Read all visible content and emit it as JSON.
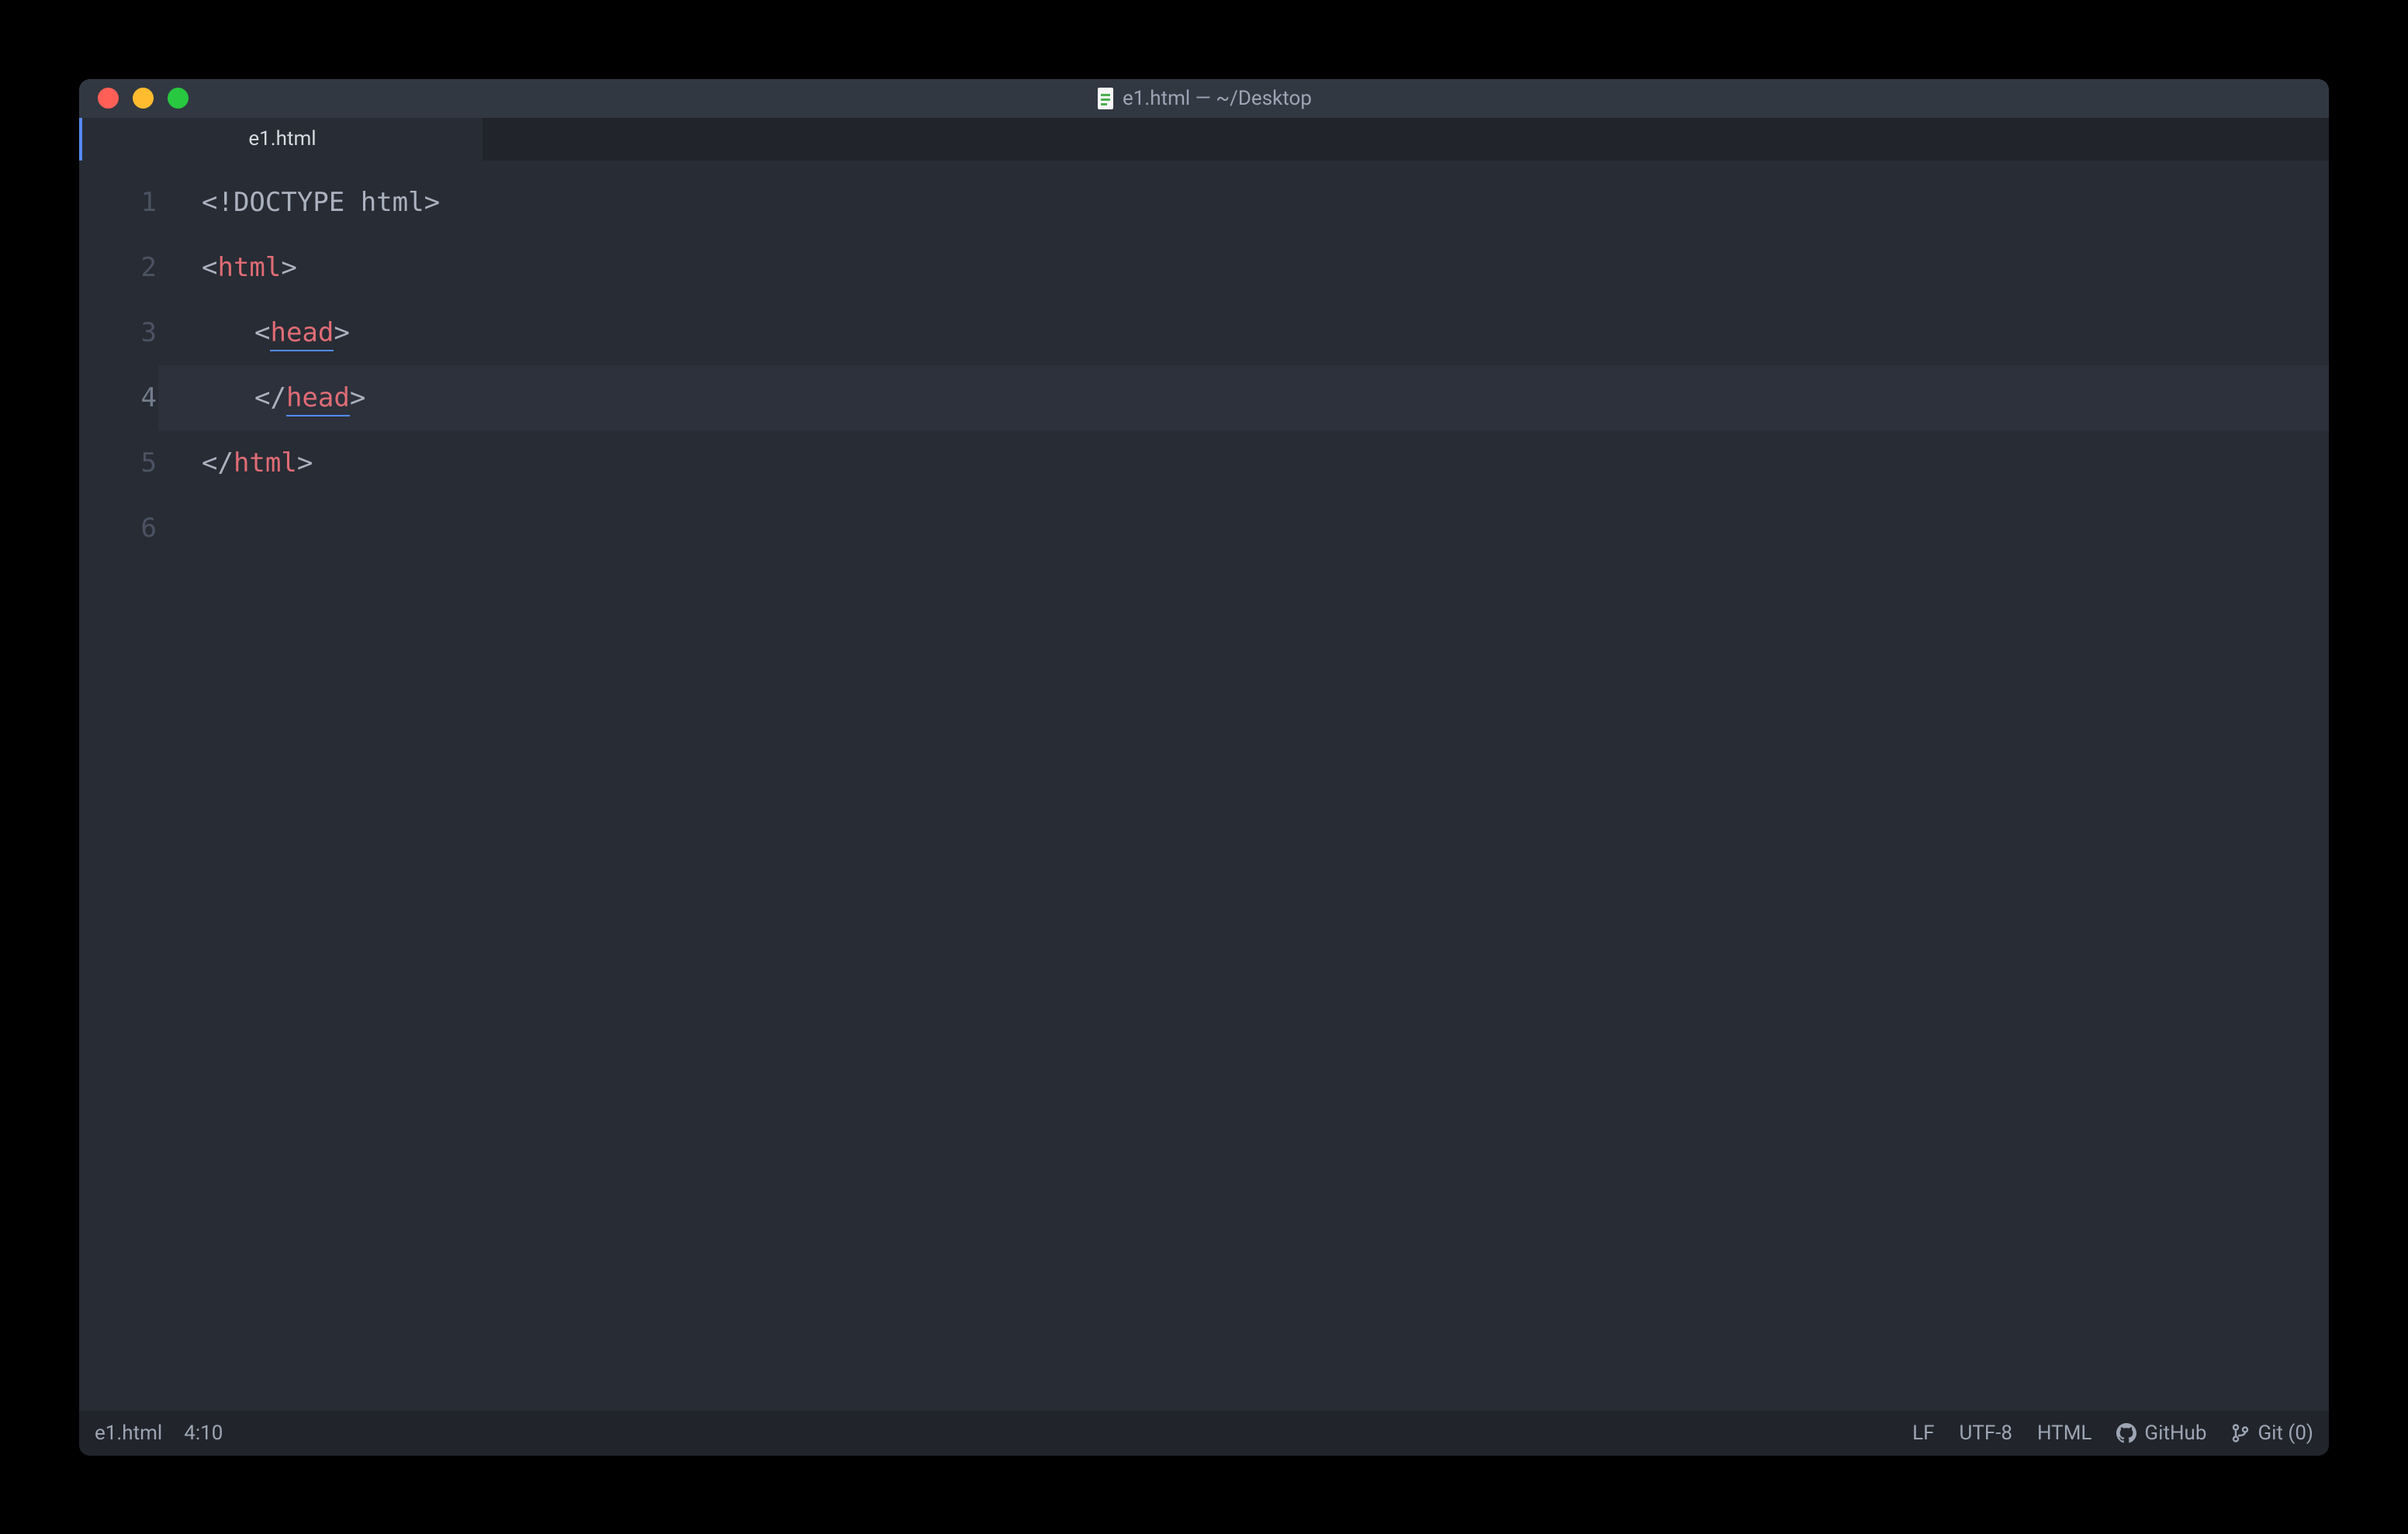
{
  "window": {
    "title": "e1.html — ~/Desktop"
  },
  "tab": {
    "filename": "e1.html"
  },
  "gutter": {
    "lines": [
      "1",
      "2",
      "3",
      "4",
      "5",
      "6"
    ],
    "active_index": 3
  },
  "code": {
    "lines": [
      {
        "type": "doctype",
        "indent": 0,
        "raw": "<!DOCTYPE html>"
      },
      {
        "type": "open",
        "indent": 0,
        "tag": "html"
      },
      {
        "type": "open",
        "indent": 1,
        "tag": "head",
        "underline": true
      },
      {
        "type": "close",
        "indent": 1,
        "tag": "head",
        "underline": true,
        "highlight": true
      },
      {
        "type": "close",
        "indent": 0,
        "tag": "html"
      },
      {
        "type": "blank",
        "indent": 0
      }
    ]
  },
  "statusbar": {
    "file": "e1.html",
    "cursor": "4:10",
    "eol": "LF",
    "encoding": "UTF-8",
    "grammar": "HTML",
    "github": "GitHub",
    "git": "Git (0)"
  }
}
